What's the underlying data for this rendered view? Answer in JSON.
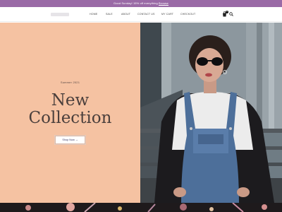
{
  "promo": {
    "text": "Good Sunday! 15% off everything ",
    "link": "Browse"
  },
  "nav": {
    "home": "HOME",
    "sale": "SALE",
    "about": "ABOUT",
    "contact": "CONTACT US",
    "cart": "MY CART",
    "checkout": "CHECKOUT"
  },
  "cart": {
    "count": "0"
  },
  "hero": {
    "kicker": "Summer 2021",
    "title_line1": "New",
    "title_line2": "Collection",
    "cta": "Shop Now →"
  },
  "colors": {
    "promo_bar": "#9a6aa6",
    "hero_panel": "#f5c2a2",
    "title_text": "#4a3f3c"
  },
  "icons": [
    "cart-icon",
    "search-icon"
  ]
}
